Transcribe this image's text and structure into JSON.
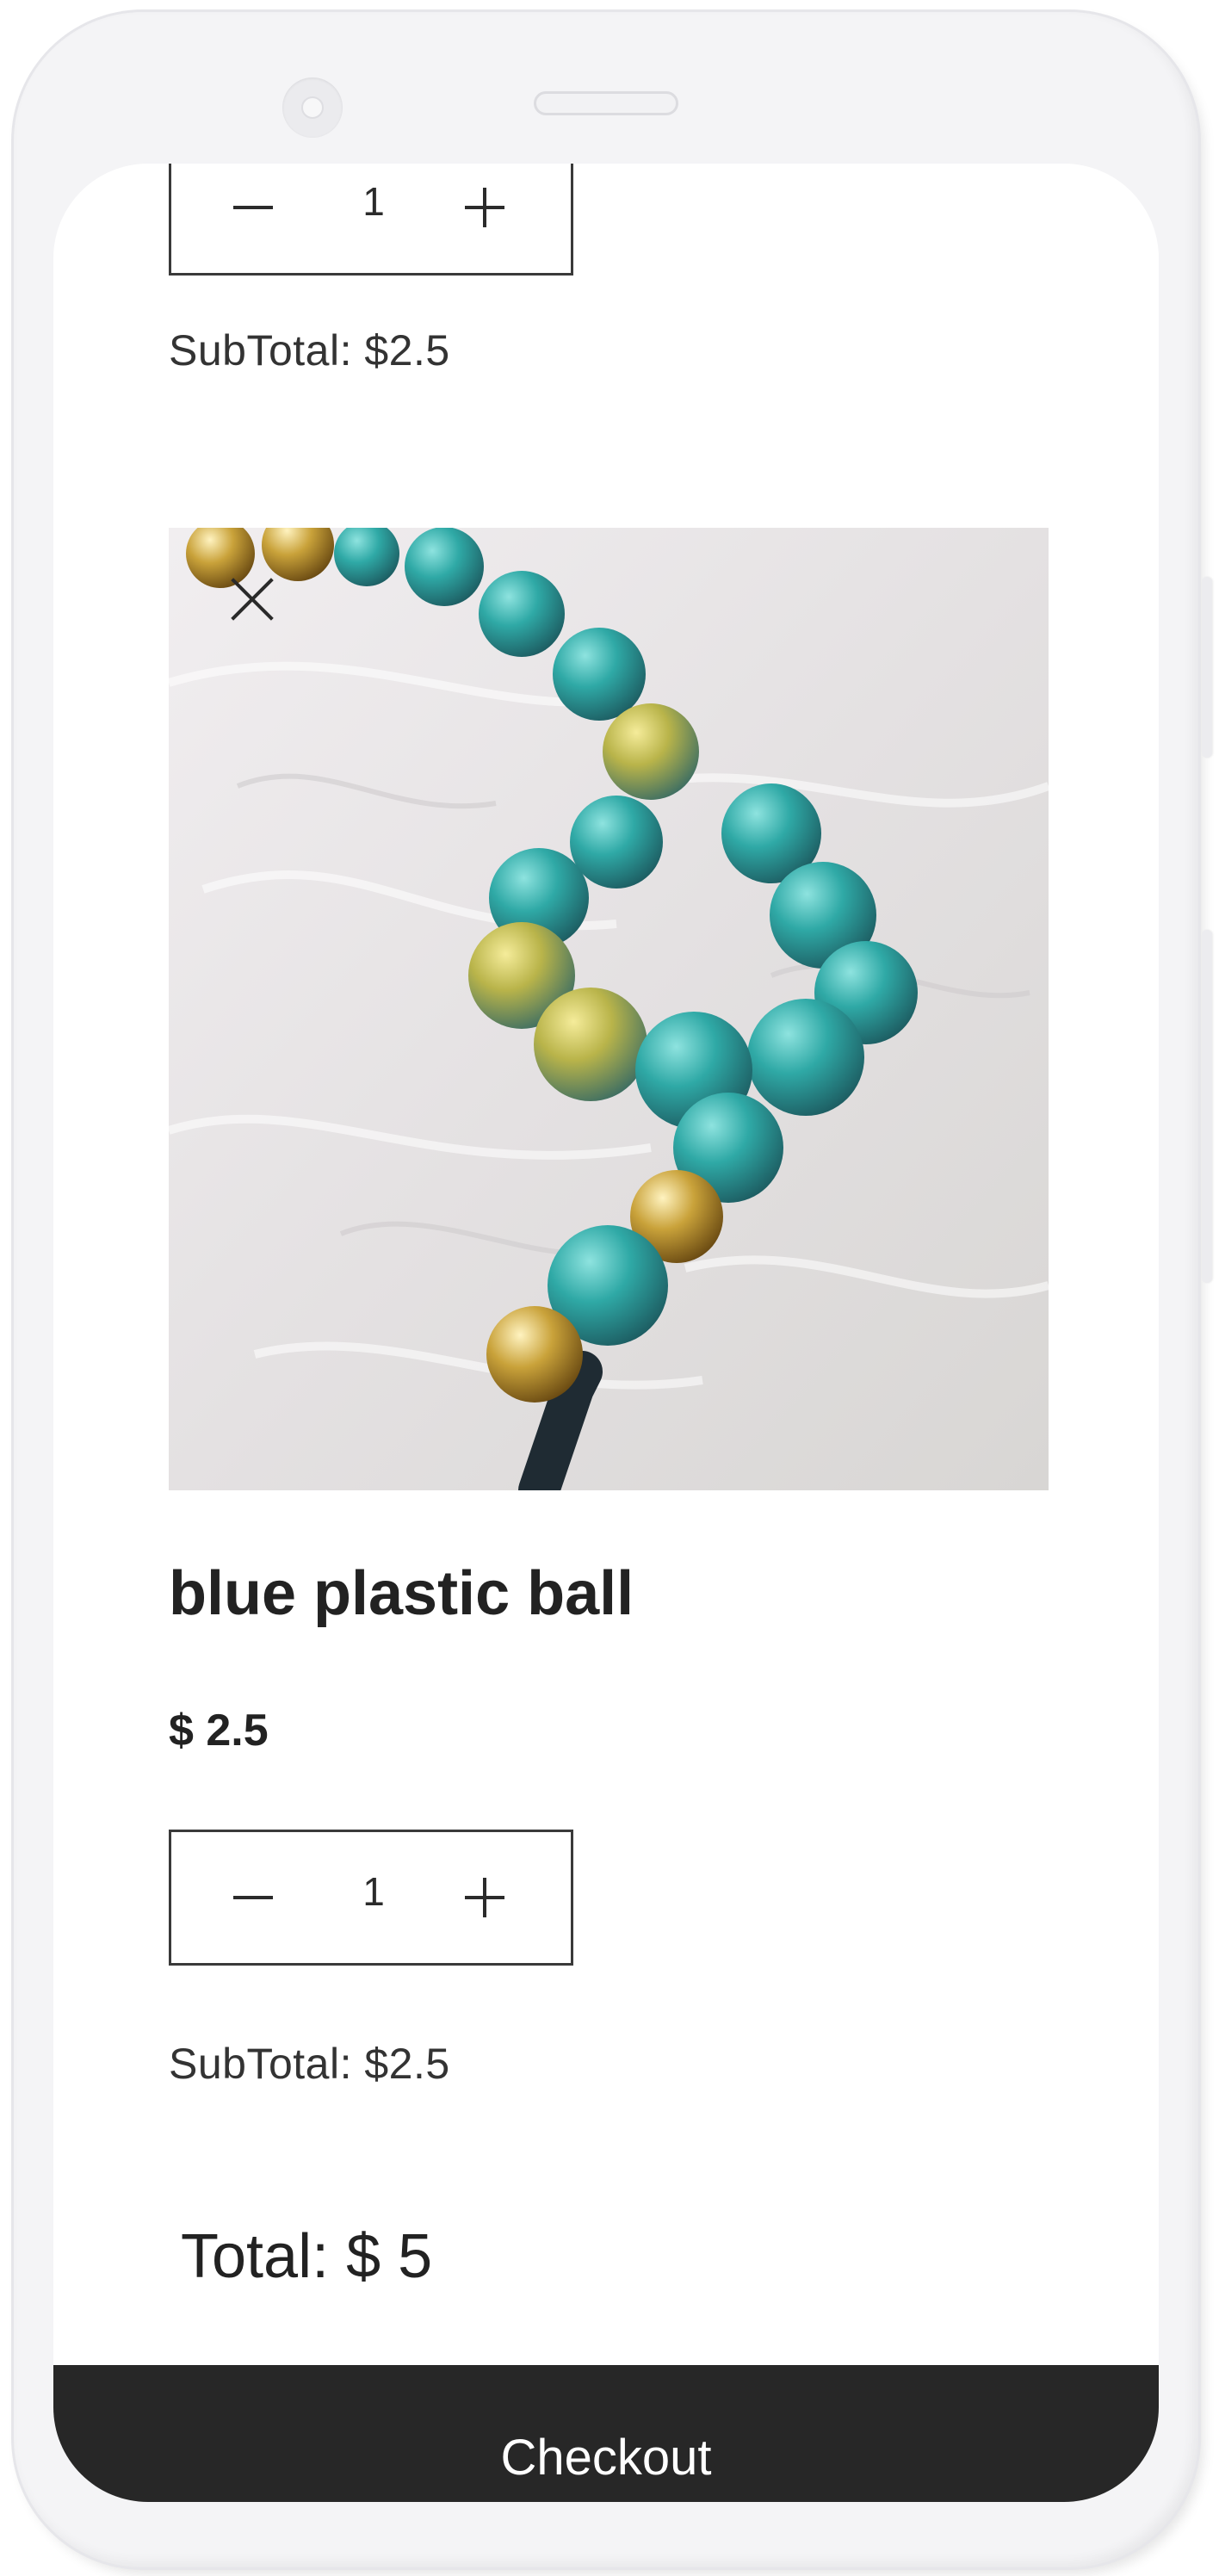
{
  "cart": {
    "items": [
      {
        "quantity": "1",
        "subtotal": "SubTotal: $2.5"
      },
      {
        "name": "blue plastic ball",
        "price": "$ 2.5",
        "quantity": "1",
        "subtotal": "SubTotal: $2.5",
        "image": "beaded-bracelet-photo"
      }
    ],
    "total": "Total: $ 5",
    "checkout_label": "Checkout"
  },
  "icons": {
    "remove": "close-icon",
    "decrement": "minus-icon",
    "increment": "plus-icon"
  },
  "colors": {
    "checkout_bar": "#272727",
    "text": "#222222",
    "bead_turquoise": "#2fa9a6",
    "bead_gold": "#c9a23a"
  }
}
